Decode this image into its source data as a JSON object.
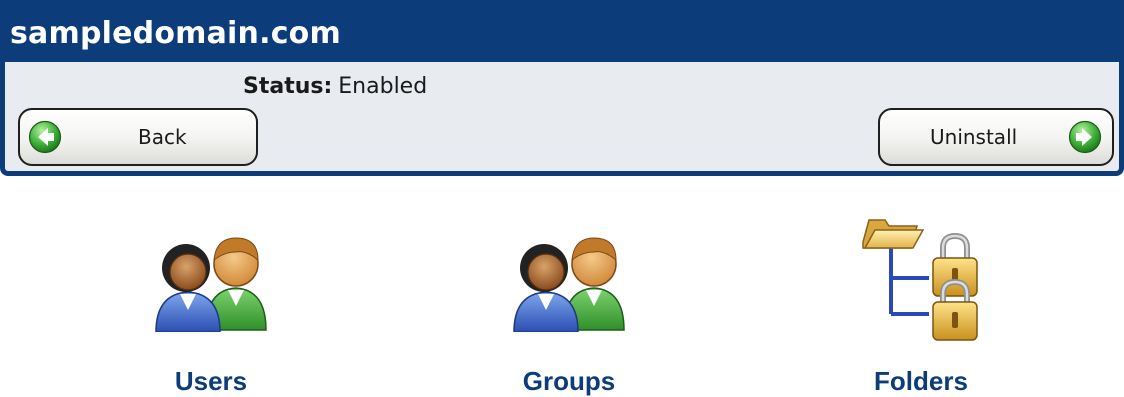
{
  "header": {
    "title": "sampledomain.com"
  },
  "status": {
    "label": "Status:",
    "value": "Enabled"
  },
  "buttons": {
    "back": "Back",
    "uninstall": "Uninstall"
  },
  "tiles": [
    {
      "label": "Users",
      "icon": "users-icon"
    },
    {
      "label": "Groups",
      "icon": "groups-icon"
    },
    {
      "label": "Folders",
      "icon": "folders-lock-icon"
    }
  ],
  "colors": {
    "header_bg": "#0c3d7a",
    "panel_bg": "#e8ebef",
    "arrow_green": "#2e9e2a",
    "link_blue": "#0c3d7a"
  }
}
